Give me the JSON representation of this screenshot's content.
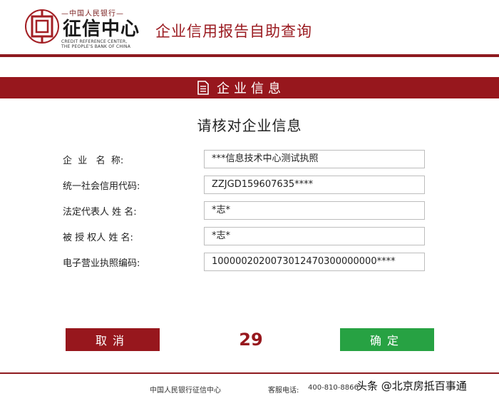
{
  "header": {
    "brand_top": "—中国人民银行—",
    "brand_main": "征信中心",
    "brand_en_line1": "CREDIT REFERENCE CENTER,",
    "brand_en_line2": "THE PEOPLE'S BANK OF CHINA",
    "app_title": "企业信用报告自助查询"
  },
  "section": {
    "title": "企业信息",
    "icon": "document-icon"
  },
  "prompt": "请核对企业信息",
  "form": {
    "rows": [
      {
        "label": "企  业   名  称:",
        "value": "***信息技术中心测试执照"
      },
      {
        "label": "统一社会信用代码:",
        "value": "ZZJGD159607635****"
      },
      {
        "label": "法定代表人 姓 名:",
        "value": "*志*"
      },
      {
        "label": "被 授 权人 姓 名:",
        "value": "*志*"
      },
      {
        "label": "电子营业执照编码:",
        "value": "1000002020073012470300000000****"
      }
    ]
  },
  "actions": {
    "cancel_label": "取消",
    "confirm_label": "确定",
    "countdown": "29"
  },
  "footer": {
    "org": "中国人民银行征信中心",
    "phone_label": "客服电话:",
    "phone": "400-810-8866"
  },
  "watermark": "头条 @北京房抵百事通",
  "colors": {
    "brand_red": "#97171d",
    "confirm_green": "#27a243"
  }
}
